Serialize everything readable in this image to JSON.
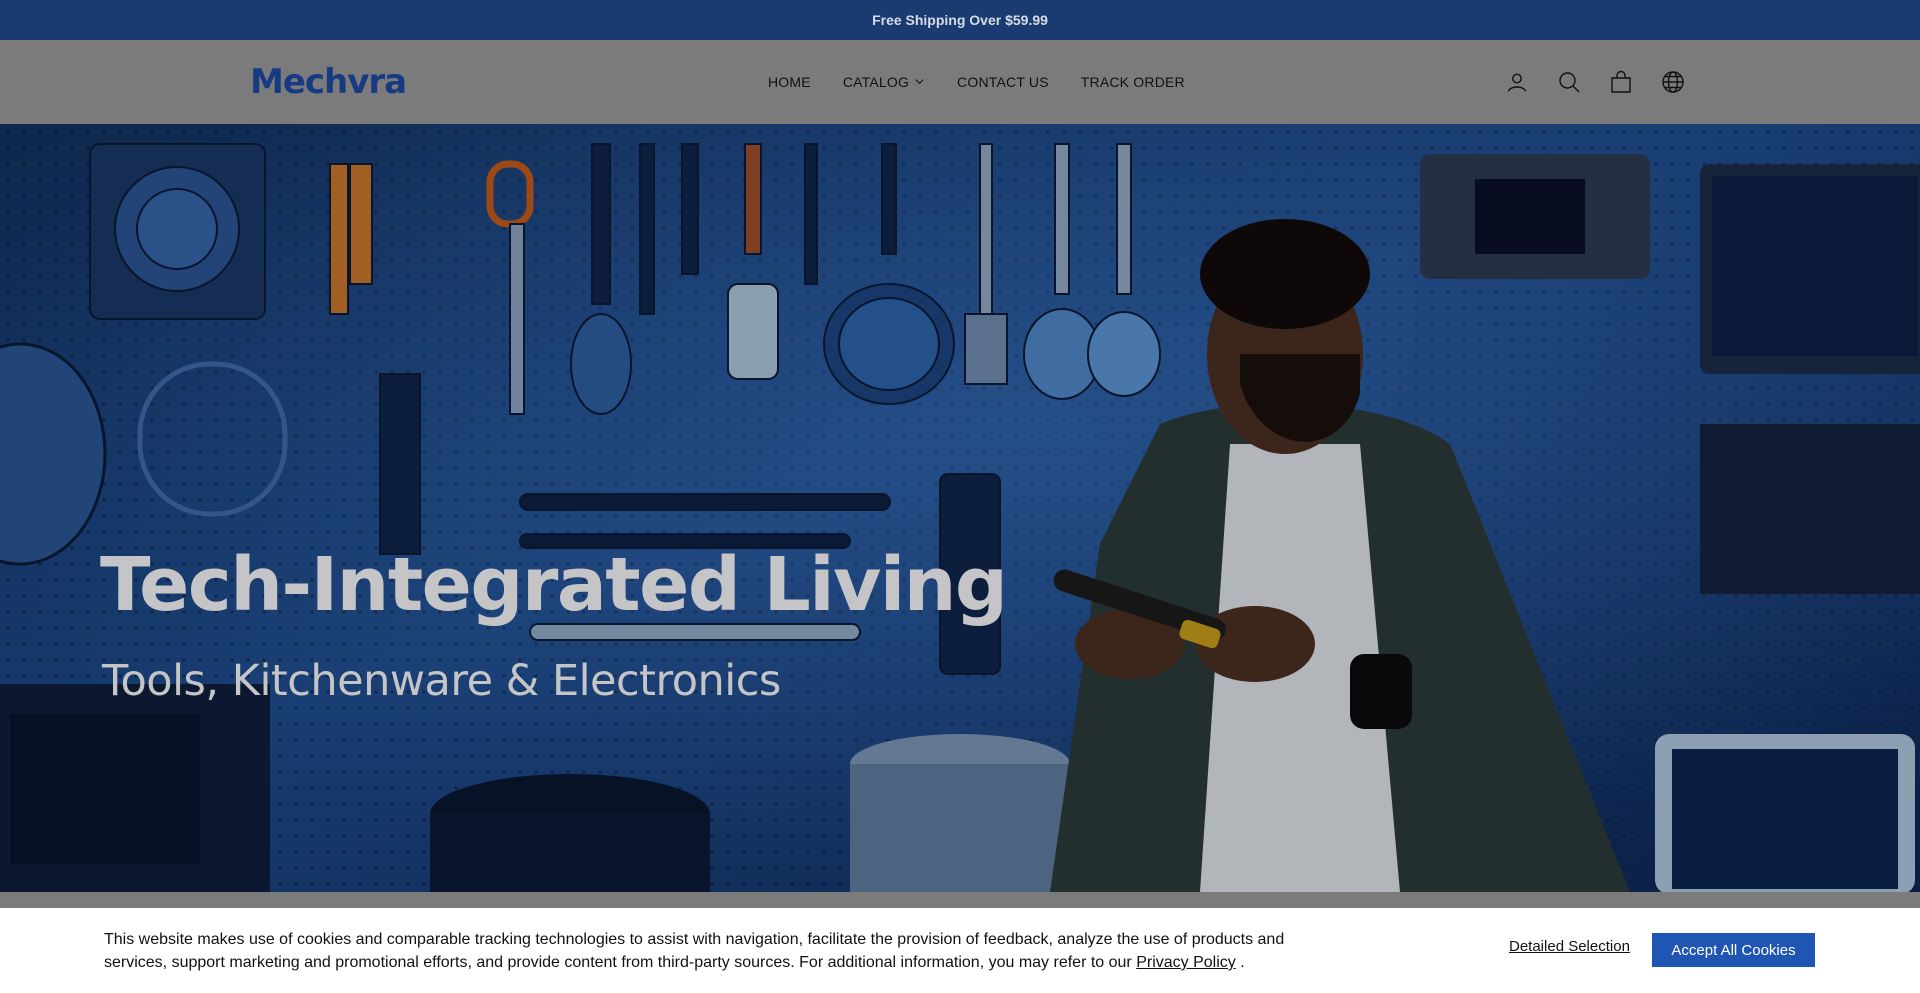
{
  "announcement": {
    "text": "Free Shipping Over $59.99"
  },
  "header": {
    "logo_text": "Mechvra",
    "nav": [
      {
        "label": "HOME"
      },
      {
        "label": "CATALOG",
        "has_dropdown": true
      },
      {
        "label": "CONTACT US"
      },
      {
        "label": "TRACK ORDER"
      }
    ],
    "icons": [
      "account-icon",
      "search-icon",
      "cart-icon",
      "globe-icon"
    ]
  },
  "hero": {
    "title": "Tech-Integrated Living",
    "subtitle": "Tools, Kitchenware & Electronics"
  },
  "cookie": {
    "text": "This website makes use of cookies and comparable tracking technologies to assist with navigation, facilitate the provision of feedback, analyze the use of products and services, support marketing and promotional efforts, and provide content from third-party sources. For additional information, you may refer to our",
    "policy_link": "Privacy Policy",
    "text_end": ".",
    "detail_label": "Detailed Selection",
    "accept_label": "Accept All Cookies"
  },
  "colors": {
    "announcement_bg": "#1a3a72",
    "header_bg": "#7b7b7b",
    "brand": "#173a82",
    "accept_button": "#1f56b3"
  }
}
